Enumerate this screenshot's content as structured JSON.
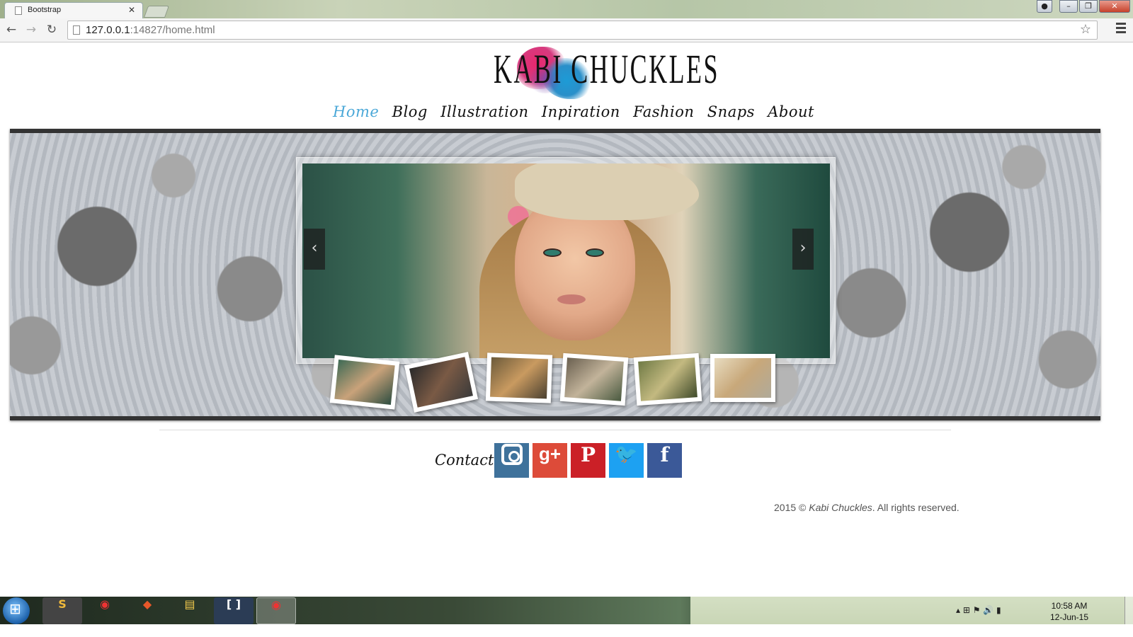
{
  "browser": {
    "tab_title": "Bootstrap",
    "tab_close": "✕",
    "url_host": "127.0.0.1",
    "url_rest": ":14827/home.html",
    "star": "☆"
  },
  "site": {
    "logo": "KABI CHUCKLES",
    "nav": [
      "Home",
      "Blog",
      "Illustration",
      "Inpiration",
      "Fashion",
      "Snaps",
      "About"
    ],
    "active_nav": "Home",
    "prev_arrow": "‹",
    "next_arrow": "›",
    "contact_label": "Contact",
    "social": {
      "googleplus": "g+",
      "pinterest": "P",
      "twitter": "🐦",
      "facebook": "f"
    },
    "footer_year": "2015 ©",
    "footer_brand": "Kabi Chuckles",
    "footer_rest": ". All rights reserved."
  },
  "taskbar": {
    "time": "10:58 AM",
    "date": "12-Jun-15"
  },
  "colors": {
    "nav_active": "#4ba8d8",
    "instagram": "#3f729b",
    "googleplus": "#dd4b39",
    "pinterest": "#cb2027",
    "twitter": "#1da1f2",
    "facebook": "#3b5998"
  }
}
